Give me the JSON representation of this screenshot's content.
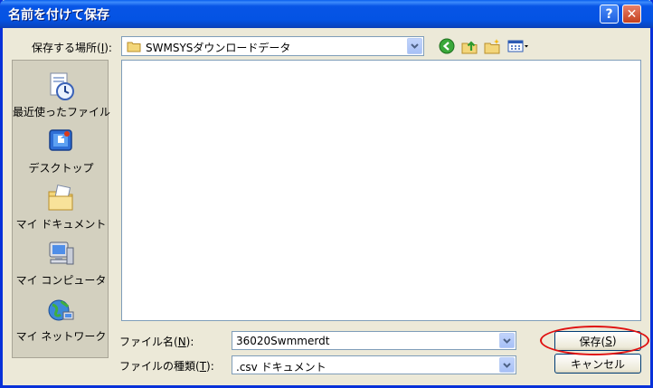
{
  "window": {
    "title": "名前を付けて保存",
    "help_glyph": "?",
    "close_glyph": "✕"
  },
  "location": {
    "label_prefix": "保存する場所(",
    "label_key": "I",
    "label_suffix": "):",
    "current_folder": "SWMSYSダウンロードデータ"
  },
  "toolbar_icons": [
    "back-icon",
    "up-folder-icon",
    "new-folder-icon",
    "view-menu-icon"
  ],
  "places": [
    {
      "label": "最近使ったファイル",
      "icon": "recent-icon"
    },
    {
      "label": "デスクトップ",
      "icon": "desktop-icon"
    },
    {
      "label": "マイ ドキュメント",
      "icon": "my-documents-icon"
    },
    {
      "label": "マイ コンピュータ",
      "icon": "my-computer-icon"
    },
    {
      "label": "マイ ネットワーク",
      "icon": "my-network-icon"
    }
  ],
  "filename": {
    "label_prefix": "ファイル名(",
    "label_key": "N",
    "label_suffix": "):",
    "value": "36020Swmmerdt"
  },
  "filetype": {
    "label_prefix": "ファイルの種類(",
    "label_key": "T",
    "label_suffix": "):",
    "value": ".csv ドキュメント"
  },
  "buttons": {
    "save_prefix": "保存(",
    "save_key": "S",
    "save_suffix": ")",
    "cancel": "キャンセル"
  },
  "colors": {
    "titlebar": "#0453e4",
    "dialog_bg": "#ece9d8",
    "highlight": "#e01010"
  }
}
